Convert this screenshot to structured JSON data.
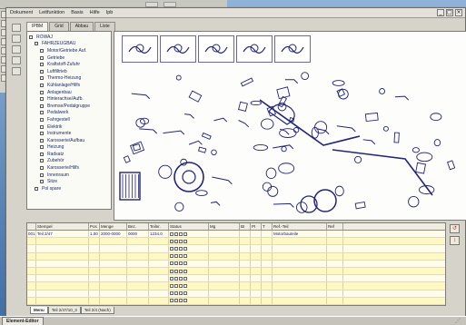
{
  "menubar": {
    "items": [
      "Dokument",
      "Leitfunktion",
      "Basis",
      "Hilfe",
      "Ipb"
    ]
  },
  "window_controls": [
    "_",
    "□",
    "×"
  ],
  "tabs": [
    {
      "label": "IPBM",
      "active": true
    },
    {
      "label": "Grid",
      "active": false
    },
    {
      "label": "Abbau",
      "active": false
    },
    {
      "label": "Liste",
      "active": false
    }
  ],
  "tree": [
    {
      "label": "ROWAJ",
      "level": 0
    },
    {
      "label": "FAHRZEUGBAU",
      "level": 1
    },
    {
      "label": "Motor/Getriebe Auf.",
      "level": 2
    },
    {
      "label": "Getriebe",
      "level": 2
    },
    {
      "label": "Kraftstoff-Zufuhr",
      "level": 2
    },
    {
      "label": "Luftfiltrieb",
      "level": 2
    },
    {
      "label": "Thermo-Heizung",
      "level": 2
    },
    {
      "label": "Kühlanlage/Hilfs",
      "level": 2
    },
    {
      "label": "Anlagenbau",
      "level": 2
    },
    {
      "label": "Hinterachse/Aufb.",
      "level": 2
    },
    {
      "label": "Bremse/Pedalgruppe",
      "level": 2
    },
    {
      "label": "Pedalwerk",
      "level": 2
    },
    {
      "label": "Fahrgestell",
      "level": 2
    },
    {
      "label": "Elektrik",
      "level": 2
    },
    {
      "label": "Instrumente",
      "level": 2
    },
    {
      "label": "Karosserie/Aufbau",
      "level": 2
    },
    {
      "label": "Heizung",
      "level": 2
    },
    {
      "label": "Radsatz",
      "level": 2
    },
    {
      "label": "Zubehör",
      "level": 2
    },
    {
      "label": "Karosserie/Hilfs",
      "level": 2
    },
    {
      "label": "Innenraum",
      "level": 2
    },
    {
      "label": "Sitze",
      "level": 2
    },
    {
      "label": "Pol spare",
      "level": 1
    }
  ],
  "table": {
    "columns": [
      "",
      "Stempel",
      "Pos",
      "Menge",
      "Bez.",
      "Teilnr.",
      "Status",
      "Mg",
      "BI",
      "PI",
      "T",
      "Ref.-Teil",
      "Ref"
    ],
    "rows": [
      [
        "001",
        "Teil 2/47",
        "1.00",
        "2000-0000",
        "0000",
        "1234.0",
        "",
        "",
        "",
        "",
        "",
        "Motorbauteile",
        ""
      ],
      [
        "",
        "",
        "",
        "",
        "",
        "",
        "",
        "",
        "",
        "",
        "",
        "",
        ""
      ],
      [
        "",
        "",
        "",
        "",
        "",
        "",
        "",
        "",
        "",
        "",
        "",
        "",
        ""
      ],
      [
        "",
        "",
        "",
        "",
        "",
        "",
        "",
        "",
        "",
        "",
        "",
        "",
        ""
      ],
      [
        "",
        "",
        "",
        "",
        "",
        "",
        "",
        "",
        "",
        "",
        "",
        "",
        ""
      ],
      [
        "",
        "",
        "",
        "",
        "",
        "",
        "",
        "",
        "",
        "",
        "",
        "",
        ""
      ],
      [
        "",
        "",
        "",
        "",
        "",
        "",
        "",
        "",
        "",
        "",
        "",
        "",
        ""
      ],
      [
        "",
        "",
        "",
        "",
        "",
        "",
        "",
        "",
        "",
        "",
        "",
        "",
        ""
      ],
      [
        "",
        "",
        "",
        "",
        "",
        "",
        "",
        "",
        "",
        "",
        "",
        "",
        ""
      ],
      [
        "",
        "",
        "",
        "",
        "",
        "",
        "",
        "",
        "",
        "",
        "",
        "",
        ""
      ]
    ]
  },
  "side_buttons": [
    "↺",
    "↕"
  ],
  "sheet_tabs": [
    {
      "label": "Menu",
      "active": true
    },
    {
      "label": "Teil 2/47/10_3",
      "active": false
    },
    {
      "label": "Teil 2/4 (Nach)",
      "active": false
    }
  ],
  "taskbar": {
    "item_label": "Element-Editor"
  },
  "colors": {
    "desktop": "#5d86b6",
    "tree_text": "#1b2b6a",
    "drawing_lines": "#22247a",
    "table_row_highlight": "#fff7c4"
  }
}
